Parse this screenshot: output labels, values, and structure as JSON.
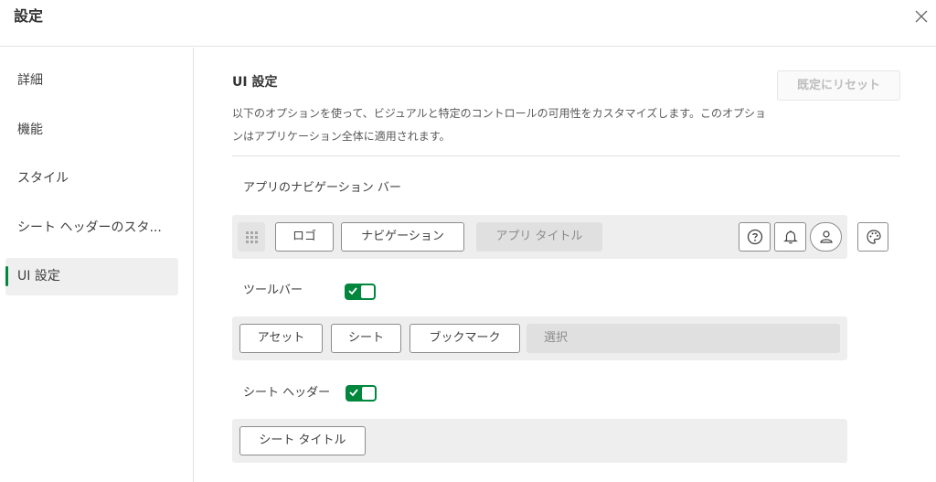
{
  "header": {
    "title": "設定"
  },
  "sidebar": {
    "items": [
      {
        "label": "詳細"
      },
      {
        "label": "機能"
      },
      {
        "label": "スタイル"
      },
      {
        "label": "シート ヘッダーのスタ..."
      },
      {
        "label": "UI 設定"
      }
    ],
    "active": "UI 設定"
  },
  "main": {
    "title": "UI 設定",
    "reset_label": "既定にリセット",
    "description": "以下のオプションを使って、ビジュアルと特定のコントロールの可用性をカスタマイズします。このオプションはアプリケーション全体に適用されます。",
    "nav_bar": {
      "label": "アプリのナビゲーション バー",
      "items": [
        "ロゴ",
        "ナビゲーション"
      ],
      "app_title": "アプリ タイトル",
      "icons": [
        "help-icon",
        "notification-bell-icon",
        "user-profile-icon"
      ]
    },
    "toolbar": {
      "label": "ツールバー",
      "enabled": true,
      "items": [
        "アセット",
        "シート",
        "ブックマーク"
      ],
      "selection": "選択"
    },
    "sheet_header": {
      "label": "シート ヘッダー",
      "enabled": true,
      "items": [
        "シート タイトル"
      ]
    }
  },
  "colors": {
    "accent": "#00873d",
    "bar_bg": "#eeeeee",
    "border": "#8c8c8c"
  }
}
